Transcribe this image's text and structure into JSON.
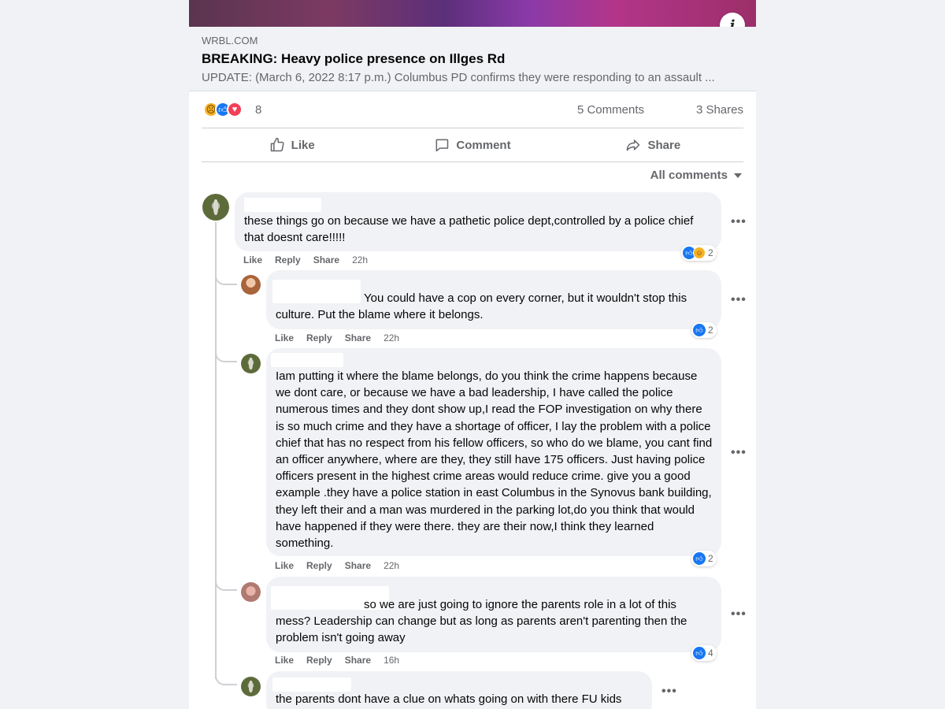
{
  "link_preview": {
    "domain": "WRBL.COM",
    "title": "BREAKING: Heavy police presence on Illges Rd",
    "description": "UPDATE: (March 6, 2022 8:17 p.m.) Columbus PD confirms they were responding to an assault ..."
  },
  "post_stats": {
    "reaction_count": "8",
    "comments": "5 Comments",
    "shares": "3 Shares"
  },
  "actions": {
    "like": "Like",
    "comment": "Comment",
    "share": "Share"
  },
  "filter": {
    "label": "All comments"
  },
  "comments": [
    {
      "text": "these things go on because we have a pathetic police dept,controlled by a police chief that doesnt care!!!!!",
      "actions": [
        "Like",
        "Reply",
        "Share"
      ],
      "time": "22h",
      "reactions": "2",
      "more": "•••"
    },
    {
      "text_line1": "You could have a cop on every corner, but it wouldn't stop this",
      "text_line2": "culture. Put the blame where it belongs.",
      "actions": [
        "Like",
        "Reply",
        "Share"
      ],
      "time": "22h",
      "reactions": "2",
      "more": "•••"
    },
    {
      "text": "Iam putting it where the blame belongs, do you think the crime happens because we dont care, or because we have a bad leadership, I have called the police numerous times and they dont show up,I read the FOP investigation on why there is so much crime and they have a shortage of officer, I lay the problem with a police chief that has no respect from his fellow officers, so who do we blame, you cant find an officer anywhere, where are they, they still have 175 officers. Just having police officers present in the highest crime areas would reduce crime. give you a good example .they have a police station in east Columbus in the Synovus bank building, they left their and a man was murdered in the parking lot,do you think that would have happened if they were there. they are their now,I think they learned something.",
      "actions": [
        "Like",
        "Reply",
        "Share"
      ],
      "time": "22h",
      "reactions": "2",
      "more": "•••"
    },
    {
      "text_line1": "so we are just going to ignore the parents role in a lot of this",
      "text_line2": "mess? Leadership can change but as long as parents aren't parenting then the problem isn't going away",
      "actions": [
        "Like",
        "Reply",
        "Share"
      ],
      "time": "16h",
      "reactions": "4",
      "more": "•••"
    },
    {
      "text": "the parents dont have a clue on whats going on with there FU kids",
      "more": "•••"
    }
  ],
  "colors": {
    "accent": "#1877f2",
    "bubble": "#f0f2f5",
    "secondary_text": "#65676b"
  }
}
